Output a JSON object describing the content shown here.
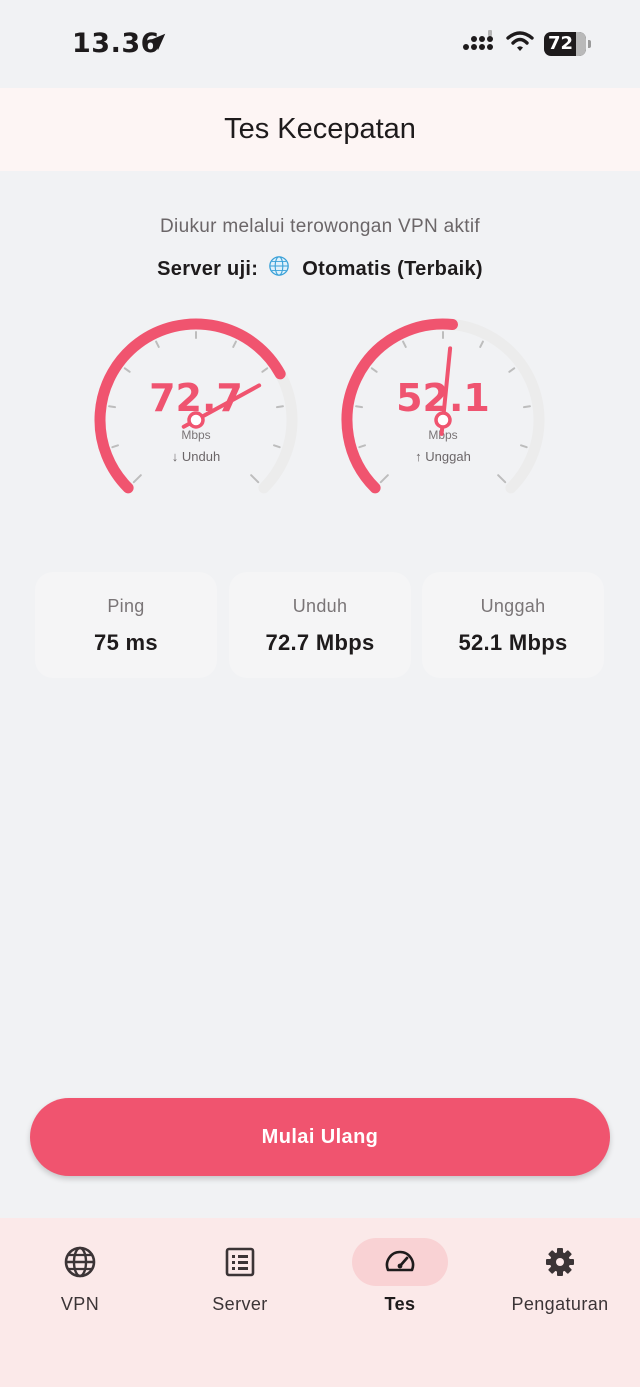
{
  "status_bar": {
    "time": "13.36",
    "battery": "72"
  },
  "header": {
    "title": "Tes Kecepatan"
  },
  "info": {
    "subtitle": "Diukur melalui terowongan VPN aktif",
    "server_label": "Server uji:",
    "server_icon": "globe-icon",
    "server_value": "Otomatis (Terbaik)"
  },
  "gauges": [
    {
      "value": "72.7",
      "level": 0.727,
      "unit": "Mbps",
      "label": "↓ Unduh"
    },
    {
      "value": "52.1",
      "level": 0.521,
      "unit": "Mbps",
      "label": "↑ Unggah"
    }
  ],
  "stats": [
    {
      "label": "Ping",
      "value": "75 ms"
    },
    {
      "label": "Unduh",
      "value": "72.7 Mbps"
    },
    {
      "label": "Unggah",
      "value": "52.1 Mbps"
    }
  ],
  "button": {
    "restart_label": "Mulai Ulang"
  },
  "nav": {
    "items": [
      {
        "label": "VPN",
        "icon": "globe-icon"
      },
      {
        "label": "Server",
        "icon": "list-icon"
      },
      {
        "label": "Tes",
        "icon": "speedometer-icon",
        "active": true
      },
      {
        "label": "Pengaturan",
        "icon": "gear-icon"
      }
    ]
  },
  "colors": {
    "accent": "#f0546f",
    "track": "#ececec",
    "background": "#f1f2f4",
    "nav_background": "#fbe9e9",
    "nav_active_pill": "#f9d2d4"
  }
}
